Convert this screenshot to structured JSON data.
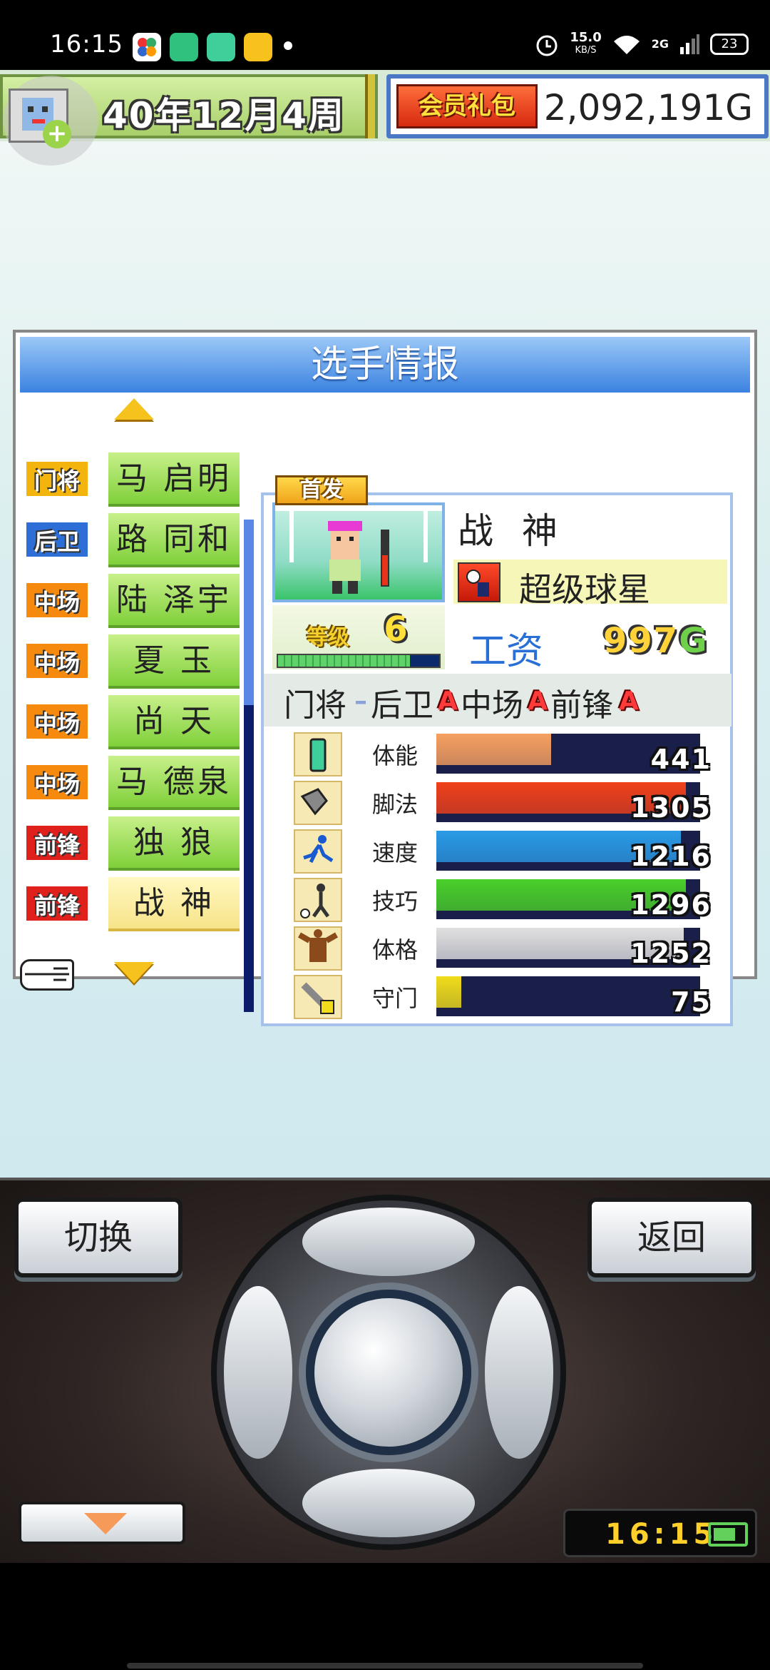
{
  "status_bar": {
    "time": "16:15",
    "net_speed_value": "15.0",
    "net_speed_unit": "KB/S",
    "signal_label": "2G",
    "battery": "23",
    "icons": [
      "alarm-icon",
      "wifi-icon",
      "signal-icon"
    ]
  },
  "header": {
    "date": "40年12月4周",
    "vip_label": "会员礼包",
    "money": "2,092,191G"
  },
  "window": {
    "title": "选手情报"
  },
  "roster": [
    {
      "position": "门将",
      "position_color": "#f4b40e",
      "name": "马 启明"
    },
    {
      "position": "后卫",
      "position_color": "#2d6fd6",
      "name": "路 同和"
    },
    {
      "position": "中场",
      "position_color": "#f58a0e",
      "name": "陆 泽宇"
    },
    {
      "position": "中场",
      "position_color": "#f58a0e",
      "name": "夏 玉"
    },
    {
      "position": "中场",
      "position_color": "#f58a0e",
      "name": "尚 天"
    },
    {
      "position": "中场",
      "position_color": "#f58a0e",
      "name": "马 德泉"
    },
    {
      "position": "前锋",
      "position_color": "#e0201a",
      "name": "独 狼"
    },
    {
      "position": "前锋",
      "position_color": "#e0201a",
      "name": "战 神"
    }
  ],
  "detail": {
    "starter_tag": "首发",
    "name": "战 神",
    "title": "超级球星",
    "level_label": "等级",
    "level": "6",
    "exp_fraction": 0.82,
    "salary_label": "工资",
    "salary_value": "997",
    "salary_unit": "G",
    "aptitudes": [
      {
        "label": "门将",
        "grade": "–"
      },
      {
        "label": "后卫",
        "grade": "A"
      },
      {
        "label": "中场",
        "grade": "A"
      },
      {
        "label": "前锋",
        "grade": "A"
      }
    ],
    "stats": [
      {
        "label": "体能",
        "value": "441",
        "fraction": 0.46,
        "color": "#f7a060",
        "icon": "battery-icon"
      },
      {
        "label": "脚法",
        "value": "1305",
        "fraction": 1.0,
        "color": "#f0401a",
        "icon": "boot-icon"
      },
      {
        "label": "速度",
        "value": "1216",
        "fraction": 0.98,
        "color": "#2a9ae6",
        "icon": "runner-icon"
      },
      {
        "label": "技巧",
        "value": "1296",
        "fraction": 1.0,
        "color": "#4ad02a",
        "icon": "dribble-icon"
      },
      {
        "label": "体格",
        "value": "1252",
        "fraction": 0.99,
        "color": "#e0e0e0",
        "icon": "muscle-icon"
      },
      {
        "label": "守门",
        "value": "75",
        "fraction": 0.1,
        "color": "#f0dc1a",
        "icon": "glove-icon"
      }
    ]
  },
  "controls": {
    "switch_label": "切换",
    "back_label": "返回",
    "clock": "16:15"
  }
}
